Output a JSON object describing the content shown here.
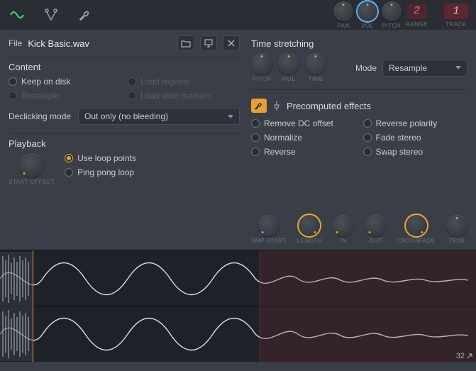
{
  "toolbar": {
    "knobs": [
      {
        "label": "PAN"
      },
      {
        "label": "VOL"
      },
      {
        "label": "PITCH"
      },
      {
        "label": "RANGE",
        "value": "2"
      },
      {
        "label": "TRACK",
        "value": "1"
      }
    ]
  },
  "file": {
    "label": "File",
    "name": "Kick Basic.wav"
  },
  "content": {
    "title": "Content",
    "options": {
      "keep_on_disk": "Keep on disk",
      "load_regions": "Load regions",
      "resample": "Resample",
      "load_slice_markers": "Load slice markers"
    },
    "declick_label": "Declicking mode",
    "declick_value": "Out only (no bleeding)"
  },
  "playback": {
    "title": "Playback",
    "start_offset_label": "START OFFSET",
    "use_loop_points": "Use loop points",
    "ping_pong": "Ping pong loop"
  },
  "time_stretch": {
    "title": "Time stretching",
    "knobs": [
      "PITCH",
      "MUL",
      "TIME"
    ],
    "mode_label": "Mode",
    "mode_value": "Resample"
  },
  "effects": {
    "title": "Precomputed effects",
    "options": {
      "remove_dc": "Remove DC offset",
      "reverse_polarity": "Reverse polarity",
      "normalize": "Normalize",
      "fade_stereo": "Fade stereo",
      "reverse": "Reverse",
      "swap_stereo": "Swap stereo"
    },
    "knobs": [
      "SMP START",
      "LENGTH",
      "IN",
      "OUT",
      "CROSSFADE",
      "TRIM"
    ]
  },
  "waveform": {
    "corner_value": "32"
  }
}
